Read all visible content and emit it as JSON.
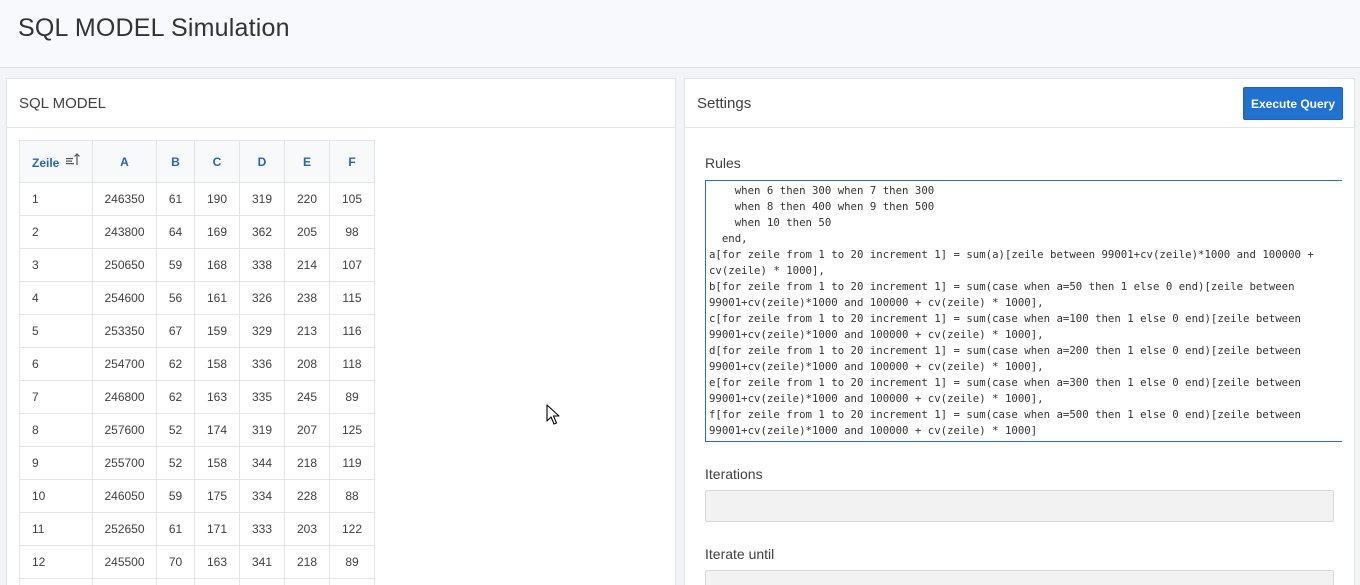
{
  "page": {
    "title": "SQL MODEL Simulation"
  },
  "left_region": {
    "title": "SQL MODEL",
    "table": {
      "headers": [
        "Zeile",
        "A",
        "B",
        "C",
        "D",
        "E",
        "F"
      ],
      "sort_icon": "sort-ascending-icon",
      "rows": [
        [
          "1",
          "246350",
          "61",
          "190",
          "319",
          "220",
          "105"
        ],
        [
          "2",
          "243800",
          "64",
          "169",
          "362",
          "205",
          "98"
        ],
        [
          "3",
          "250650",
          "59",
          "168",
          "338",
          "214",
          "107"
        ],
        [
          "4",
          "254600",
          "56",
          "161",
          "326",
          "238",
          "115"
        ],
        [
          "5",
          "253350",
          "67",
          "159",
          "329",
          "213",
          "116"
        ],
        [
          "6",
          "254700",
          "62",
          "158",
          "336",
          "208",
          "118"
        ],
        [
          "7",
          "246800",
          "62",
          "163",
          "335",
          "245",
          "89"
        ],
        [
          "8",
          "257600",
          "52",
          "174",
          "319",
          "207",
          "125"
        ],
        [
          "9",
          "255700",
          "52",
          "158",
          "344",
          "218",
          "119"
        ],
        [
          "10",
          "246050",
          "59",
          "175",
          "334",
          "228",
          "88"
        ],
        [
          "11",
          "252650",
          "61",
          "171",
          "333",
          "203",
          "122"
        ],
        [
          "12",
          "245500",
          "70",
          "163",
          "341",
          "218",
          "89"
        ],
        [
          "",
          "",
          "",
          "",
          "",
          "",
          ""
        ]
      ]
    }
  },
  "right_region": {
    "title": "Settings",
    "execute_label": "Execute Query",
    "rules_label": "Rules",
    "rules_text": "    when 6 then 300 when 7 then 300\n    when 8 then 400 when 9 then 500\n    when 10 then 50\n  end,\na[for zeile from 1 to 20 increment 1] = sum(a)[zeile between 99001+cv(zeile)*1000 and 100000 +\ncv(zeile) * 1000],\nb[for zeile from 1 to 20 increment 1] = sum(case when a=50 then 1 else 0 end)[zeile between\n99001+cv(zeile)*1000 and 100000 + cv(zeile) * 1000],\nc[for zeile from 1 to 20 increment 1] = sum(case when a=100 then 1 else 0 end)[zeile between\n99001+cv(zeile)*1000 and 100000 + cv(zeile) * 1000],\nd[for zeile from 1 to 20 increment 1] = sum(case when a=200 then 1 else 0 end)[zeile between\n99001+cv(zeile)*1000 and 100000 + cv(zeile) * 1000],\ne[for zeile from 1 to 20 increment 1] = sum(case when a=300 then 1 else 0 end)[zeile between\n99001+cv(zeile)*1000 and 100000 + cv(zeile) * 1000],\nf[for zeile from 1 to 20 increment 1] = sum(case when a=500 then 1 else 0 end)[zeile between\n99001+cv(zeile)*1000 and 100000 + cv(zeile) * 1000]",
    "iterations_label": "Iterations",
    "iterations_value": "",
    "iterate_until_label": "Iterate until",
    "iterate_until_value": ""
  },
  "colors": {
    "accent": "#1f72d0",
    "header_text": "#2466b8"
  }
}
